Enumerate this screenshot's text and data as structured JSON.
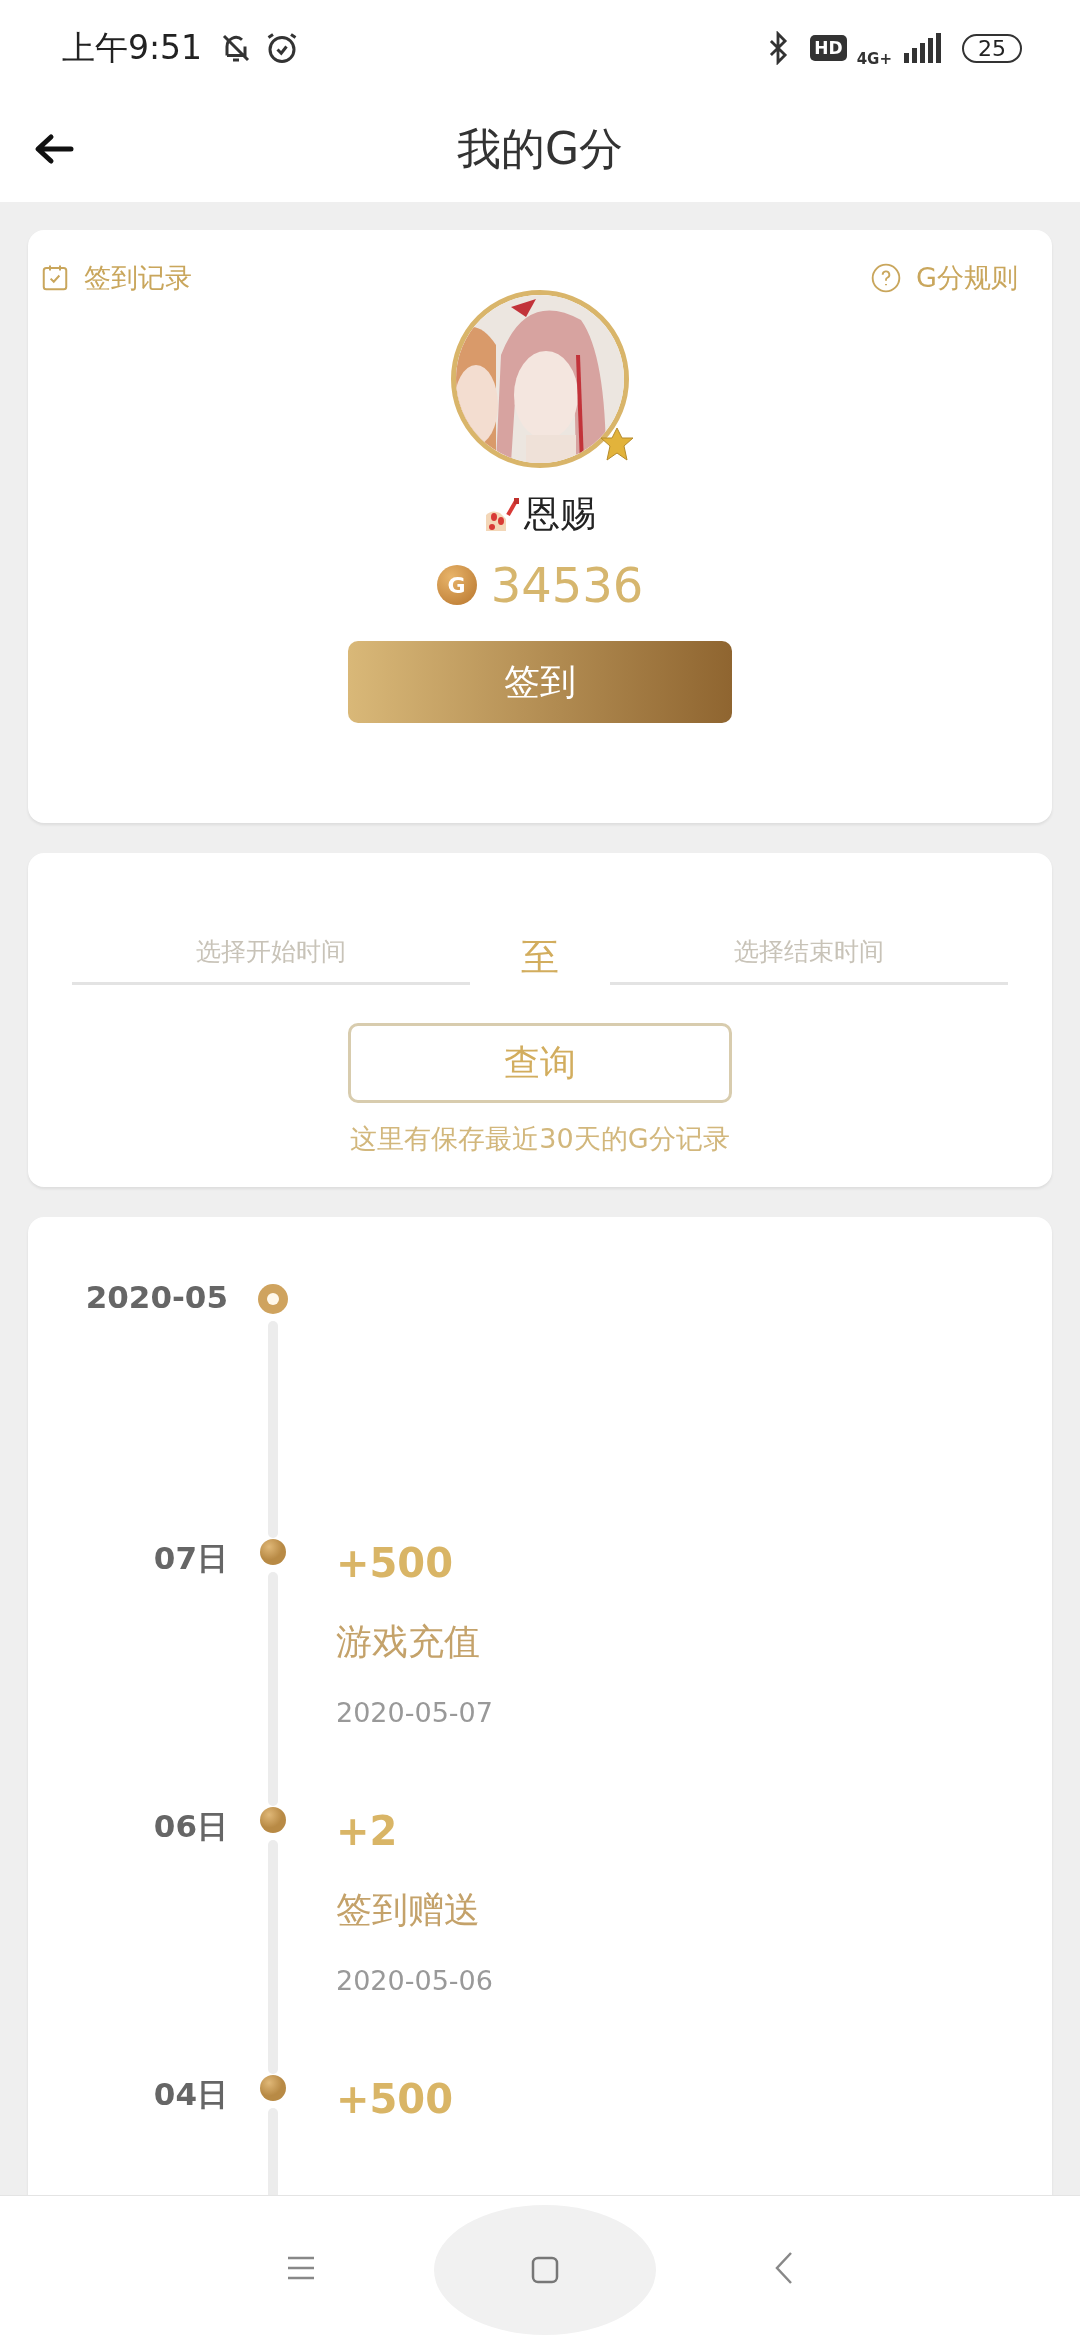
{
  "status_bar": {
    "time": "上午9:51",
    "hd": "HD",
    "network": "4G+",
    "battery": "25"
  },
  "header": {
    "title": "我的G分"
  },
  "profile": {
    "checkin_record": "签到记录",
    "rules": "G分规则",
    "name": "恩赐",
    "points": "34536",
    "coin": "G",
    "checkin_button": "签到"
  },
  "query": {
    "start_placeholder": "选择开始时间",
    "separator": "至",
    "end_placeholder": "选择结束时间",
    "button": "查询",
    "note": "这里有保存最近30天的G分记录"
  },
  "timeline": {
    "month": "2020-05",
    "entries": [
      {
        "day": "07日",
        "amount": "+500",
        "description": "游戏充值",
        "date": "2020-05-07"
      },
      {
        "day": "06日",
        "amount": "+2",
        "description": "签到赠送",
        "date": "2020-05-06"
      },
      {
        "day": "04日",
        "amount": "+500"
      }
    ]
  }
}
